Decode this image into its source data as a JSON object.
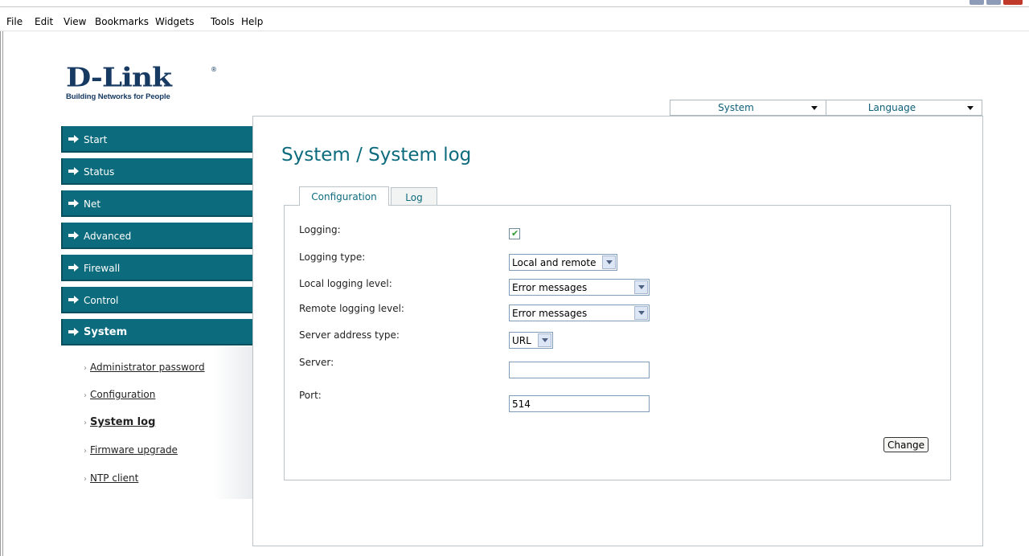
{
  "menubar": {
    "items": [
      {
        "label": "File"
      },
      {
        "label": "Edit"
      },
      {
        "label": "View"
      },
      {
        "label": "Bookmarks"
      },
      {
        "label": "Widgets"
      },
      {
        "label": "Tools"
      },
      {
        "label": "Help"
      }
    ]
  },
  "logo": {
    "word": "D-Link",
    "registered": "®",
    "tagline": "Building Networks for People"
  },
  "top_selects": {
    "system": "System",
    "language": "Language"
  },
  "sidebar": {
    "nav": [
      {
        "label": "Start"
      },
      {
        "label": "Status"
      },
      {
        "label": "Net"
      },
      {
        "label": "Advanced"
      },
      {
        "label": "Firewall"
      },
      {
        "label": "Control"
      },
      {
        "label": "System",
        "active": true
      }
    ],
    "submenu": [
      {
        "label": "Administrator password"
      },
      {
        "label": "Configuration"
      },
      {
        "label": "System log",
        "current": true
      },
      {
        "label": "Firmware upgrade"
      },
      {
        "label": "NTP client"
      }
    ]
  },
  "page": {
    "title": "System / System log",
    "tabs": [
      {
        "label": "Configuration",
        "active": true
      },
      {
        "label": "Log",
        "active": false
      }
    ]
  },
  "form": {
    "logging": {
      "label": "Logging:",
      "checked": true
    },
    "logging_type": {
      "label": "Logging type:",
      "value": "Local and remote"
    },
    "local_level": {
      "label": "Local logging level:",
      "value": "Error messages"
    },
    "remote_level": {
      "label": "Remote logging level:",
      "value": "Error messages"
    },
    "server_addr_type": {
      "label": "Server address type:",
      "value": "URL"
    },
    "server": {
      "label": "Server:",
      "value": ""
    },
    "port": {
      "label": "Port:",
      "value": "514"
    },
    "change_label": "Change"
  },
  "colors": {
    "accent": "#0d6b7e",
    "brand": "#173a63"
  }
}
